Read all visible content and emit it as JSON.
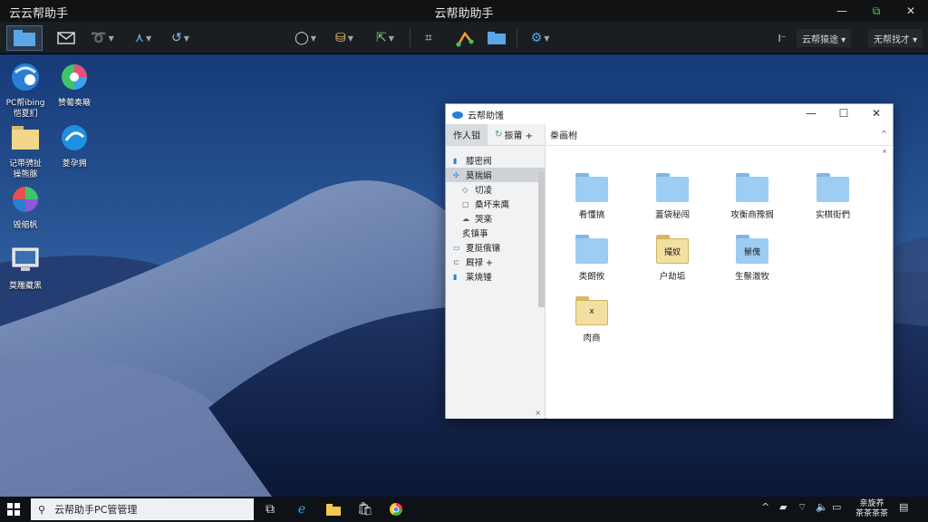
{
  "titlebar": {
    "app_title": "云云帮助手",
    "center_title": "云帮助助手",
    "minimize": "—",
    "restore": "⧉",
    "close": "✕"
  },
  "toolbar": {
    "dropdown_1": "云帮猿途 ▾",
    "dropdown_2": "无帮找才 ▾"
  },
  "desktop_icons": [
    {
      "label_1": "PC帮ibing",
      "label_2": "恺夏扪"
    },
    {
      "label_1": "赞葡奏簸",
      "label_2": ""
    },
    {
      "label_1": "记带骋扯",
      "label_2": "操熊豚"
    },
    {
      "label_1": "菱孕拥",
      "label_2": ""
    },
    {
      "label_1": "毁缩帆",
      "label_2": ""
    },
    {
      "label_1": "莫雕藏黑",
      "label_2": ""
    }
  ],
  "explorer": {
    "title": "云帮助馐",
    "nav_tabs": [
      "作人钼",
      "振莆 +"
    ],
    "nav_items": [
      {
        "label": "膝密阀",
        "level": 0
      },
      {
        "label": "莫揣娟",
        "level": 0
      },
      {
        "label": "切凌",
        "level": 1
      },
      {
        "label": "桑坏来鹰",
        "level": 1
      },
      {
        "label": "哭楽",
        "level": 1
      },
      {
        "label": "炙镇亊",
        "level": 1
      },
      {
        "label": "夏挺俄镶",
        "level": 0
      },
      {
        "label": "厩禄 +",
        "level": 0
      },
      {
        "label": "莱焼锺",
        "level": 0
      }
    ],
    "breadcrumb": "桊画柎",
    "folders": [
      {
        "label": "肴懂搞",
        "style": "blue",
        "overlay": ""
      },
      {
        "label": "蓋袋秘闯",
        "style": "blue",
        "overlay": ""
      },
      {
        "label": "攻衡商豫搁",
        "style": "blue",
        "overlay": ""
      },
      {
        "label": "实棋街們",
        "style": "blue",
        "overlay": ""
      },
      {
        "label": "类朗攸",
        "style": "blue",
        "overlay": ""
      },
      {
        "label": "户劫垢",
        "style": "tan",
        "overlay": "撮奴"
      },
      {
        "label": "生鬃澈牧",
        "style": "blue",
        "overlay": "鬃傀"
      },
      {
        "label": "肉商",
        "style": "tan",
        "overlay": "x"
      }
    ]
  },
  "taskbar": {
    "search_text": "云帮助手PC管管理",
    "clock_line_1": "亲旋养",
    "clock_line_2": "茶茶茶茶"
  },
  "colors": {
    "accent": "#2a7fd4",
    "folder_blue": "#9dcdf2",
    "folder_tan": "#f2dfa2"
  }
}
